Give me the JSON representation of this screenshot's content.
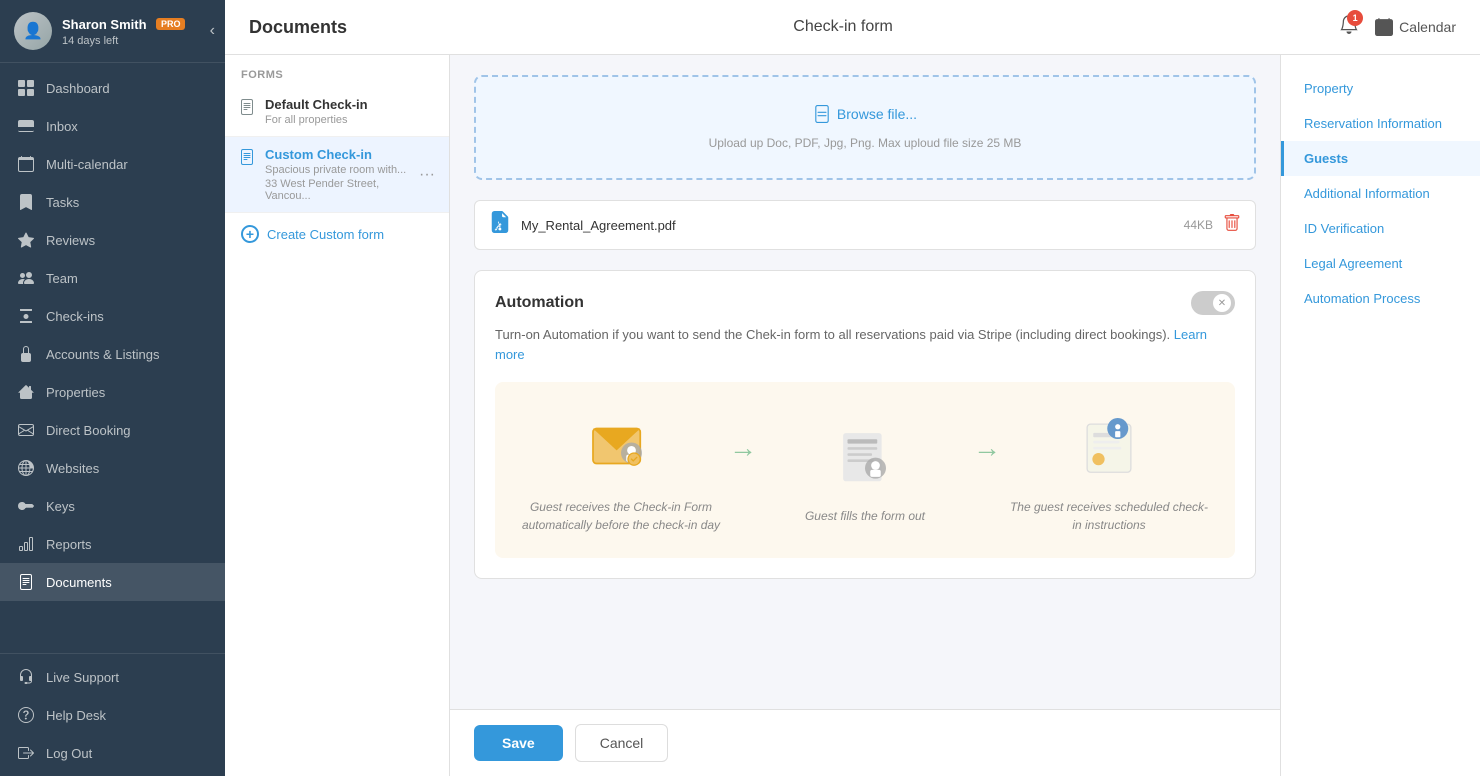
{
  "sidebar": {
    "user": {
      "name": "Sharon Smith",
      "badge": "PRO",
      "days_left": "14 days left"
    },
    "nav_items": [
      {
        "id": "dashboard",
        "label": "Dashboard",
        "icon": "grid"
      },
      {
        "id": "inbox",
        "label": "Inbox",
        "icon": "inbox"
      },
      {
        "id": "multi-calendar",
        "label": "Multi-calendar",
        "icon": "calendar-multi"
      },
      {
        "id": "tasks",
        "label": "Tasks",
        "icon": "tasks"
      },
      {
        "id": "reviews",
        "label": "Reviews",
        "icon": "star"
      },
      {
        "id": "team",
        "label": "Team",
        "icon": "team"
      },
      {
        "id": "check-ins",
        "label": "Check-ins",
        "icon": "check-ins"
      },
      {
        "id": "accounts-listings",
        "label": "Accounts & Listings",
        "icon": "accounts"
      },
      {
        "id": "properties",
        "label": "Properties",
        "icon": "properties"
      },
      {
        "id": "direct-booking",
        "label": "Direct Booking",
        "icon": "direct"
      },
      {
        "id": "websites",
        "label": "Websites",
        "icon": "websites"
      },
      {
        "id": "keys",
        "label": "Keys",
        "icon": "keys"
      },
      {
        "id": "reports",
        "label": "Reports",
        "icon": "reports"
      },
      {
        "id": "documents",
        "label": "Documents",
        "icon": "documents",
        "active": true
      }
    ],
    "footer_items": [
      {
        "id": "live-support",
        "label": "Live Support",
        "icon": "support"
      },
      {
        "id": "help-desk",
        "label": "Help Desk",
        "icon": "help"
      },
      {
        "id": "log-out",
        "label": "Log Out",
        "icon": "logout"
      }
    ]
  },
  "topbar": {
    "left_title": "Documents",
    "center_title": "Check-in form",
    "notification_count": "1",
    "calendar_label": "Calendar"
  },
  "forms_panel": {
    "section_label": "FORMS",
    "items": [
      {
        "id": "default-check-in",
        "title": "Default Check-in",
        "subtitle": "For all properties"
      },
      {
        "id": "custom-check-in",
        "title": "Custom Check-in",
        "subtitle": "Spacious private room with...",
        "address": "33 West Pender Street, Vancou...",
        "has_menu": true
      }
    ],
    "create_label": "Create Custom form"
  },
  "upload_area": {
    "browse_label": "Browse file...",
    "hint": "Upload up  Doc, PDF, Jpg, Png. Max uploud file size 25 MB"
  },
  "file_item": {
    "name": "My_Rental_Agreement.pdf",
    "size": "44KB"
  },
  "automation": {
    "title": "Automation",
    "toggle_state": "off",
    "description": "Turn-on Automation if you want to send the Chek-in form to all reservations paid via Stripe (including direct bookings).",
    "learn_more_label": "Learn more",
    "steps": [
      {
        "id": "step-1",
        "text": "Guest receives the Check-in Form automatically before the check-in day"
      },
      {
        "id": "step-2",
        "text": "Guest fills the form out"
      },
      {
        "id": "step-3",
        "text": "The guest receives scheduled check-in instructions"
      }
    ]
  },
  "bottom_bar": {
    "save_label": "Save",
    "cancel_label": "Cancel"
  },
  "right_sidebar": {
    "items": [
      {
        "id": "property",
        "label": "Property",
        "active": false
      },
      {
        "id": "reservation-information",
        "label": "Reservation Information",
        "active": false
      },
      {
        "id": "guests",
        "label": "Guests",
        "active": true
      },
      {
        "id": "additional-information",
        "label": "Additional Information",
        "active": false
      },
      {
        "id": "id-verification",
        "label": "ID Verification",
        "active": false
      },
      {
        "id": "legal-agreement",
        "label": "Legal Agreement",
        "active": false
      },
      {
        "id": "automation-process",
        "label": "Automation Process",
        "active": false
      }
    ]
  }
}
